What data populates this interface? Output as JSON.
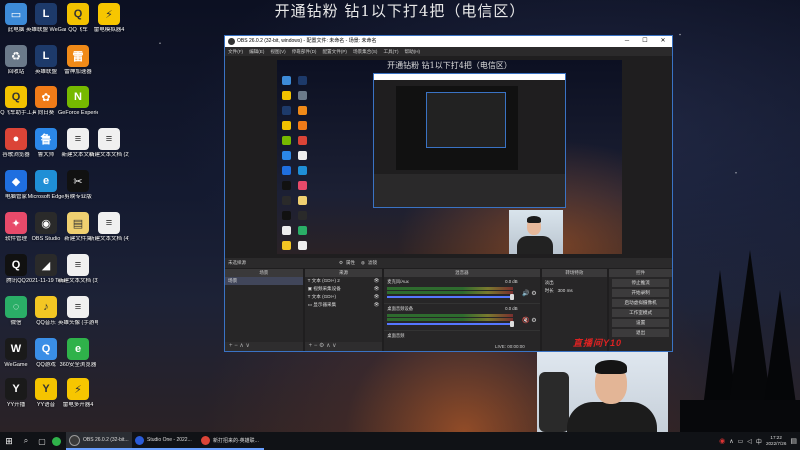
{
  "overlay_title": "开通钻粉 钻1以下打4把（电信区）",
  "desktop": {
    "icons": [
      {
        "label": "此电脑",
        "color": "#3d8bd8",
        "glyph": "▭"
      },
      {
        "label": "英雄联盟 WeGame版",
        "color": "#1d3a6a",
        "glyph": "L"
      },
      {
        "label": "QQ飞车",
        "color": "#f2c200",
        "glyph": "Q"
      },
      {
        "label": "雷电模拟器4",
        "color": "#f7c600",
        "glyph": "⚡"
      },
      {
        "label": "回收站",
        "color": "#6b7a8a",
        "glyph": "♻"
      },
      {
        "label": "英雄联盟",
        "color": "#1d3a6a",
        "glyph": "L"
      },
      {
        "label": "雷神加速器",
        "color": "#f08a18",
        "glyph": "雷"
      },
      {
        "label": "QQ飞车助手工具",
        "color": "#f2c200",
        "glyph": "Q"
      },
      {
        "label": "向日葵",
        "color": "#f07b18",
        "glyph": "✿"
      },
      {
        "label": "GeForce Experience",
        "color": "#76b900",
        "glyph": "N"
      },
      {
        "label": "谷歌浏览器",
        "color": "#db4437",
        "glyph": "●"
      },
      {
        "label": "鲁大师",
        "color": "#2b87e8",
        "glyph": "鲁"
      },
      {
        "label": "新建文本文档",
        "color": "#f0f0f0",
        "glyph": "≡"
      },
      {
        "label": "新建文本文档 (2)",
        "color": "#f0f0f0",
        "glyph": "≡"
      },
      {
        "label": "电脑管家",
        "color": "#1f6fe0",
        "glyph": "◆"
      },
      {
        "label": "Microsoft Edge",
        "color": "#1f8fd6",
        "glyph": "e"
      },
      {
        "label": "剪映专业版",
        "color": "#111111",
        "glyph": "✂"
      },
      {
        "label": "软件管理",
        "color": "#e84a6a",
        "glyph": "✦"
      },
      {
        "label": "OBS Studio",
        "color": "#2a2a2a",
        "glyph": "◉"
      },
      {
        "label": "新建文件夹",
        "color": "#f0d070",
        "glyph": "▤"
      },
      {
        "label": "新建文本文档 (4)",
        "color": "#f0f0f0",
        "glyph": "≡"
      },
      {
        "label": "腾讯QQ",
        "color": "#111111",
        "glyph": "Q"
      },
      {
        "label": "2021-11-19 Team AR...",
        "color": "#2a2a2a",
        "glyph": "◢"
      },
      {
        "label": "新建文本文档 (3)",
        "color": "#f0f0f0",
        "glyph": "≡"
      },
      {
        "label": "微信",
        "color": "#2aae67",
        "glyph": "◌"
      },
      {
        "label": "QQ音乐",
        "color": "#f3c623",
        "glyph": "♪"
      },
      {
        "label": "英雄头像 (手游电脑版)",
        "color": "#f0f0f0",
        "glyph": "≡"
      },
      {
        "label": "WeGame",
        "color": "#1a1a1a",
        "glyph": "W"
      },
      {
        "label": "QQ游戏",
        "color": "#3a8ee6",
        "glyph": "Q"
      },
      {
        "label": "360安全浏览器",
        "color": "#2fb24a",
        "glyph": "e"
      },
      {
        "label": "YY开播",
        "color": "#1a1a1a",
        "glyph": "Y"
      },
      {
        "label": "YY语音",
        "color": "#f5c400",
        "glyph": "Y"
      },
      {
        "label": "雷电多开器4",
        "color": "#f7c600",
        "glyph": "⚡"
      }
    ]
  },
  "obs": {
    "title": "OBS 26.0.2 (32-bit, windows) - 配置文件: 未命名 - 场景: 未命名",
    "menu": [
      "文件(F)",
      "编辑(E)",
      "视图(V)",
      "停靠部件(D)",
      "配置文件(P)",
      "场景集合(S)",
      "工具(T)",
      "帮助(H)"
    ],
    "preview_title": "开通钻粉 钻1以下打4把（电信区）",
    "no_source_selected": "未选择源",
    "properties_label": "属性",
    "filters_label": "滤镜",
    "docks": {
      "scenes": {
        "header": "场景",
        "items": [
          "场景"
        ]
      },
      "sources": {
        "header": "来源",
        "items": [
          "文本 (GDI+) 2",
          "视频采集设备",
          "文本 (GDI+)",
          "显示器采集"
        ]
      },
      "mixer": {
        "header": "混音器",
        "channels": [
          {
            "name": "麦克风/Aux",
            "db": "0.0 dB"
          },
          {
            "name": "桌面音频设备",
            "db": "0.0 dB"
          },
          {
            "name": "桌面音频",
            "db": ""
          }
        ]
      },
      "transitions": {
        "header": "转场特效",
        "type": "淡出",
        "duration_label": "时长",
        "duration": "300 ms"
      },
      "controls": {
        "header": "控件",
        "buttons": [
          "停止推流",
          "开始录制",
          "启动虚拟摄像机",
          "工作室模式",
          "设置",
          "退出"
        ]
      }
    },
    "status": {
      "live": "LIVE:",
      "time": "00:00:00"
    }
  },
  "watermark": "直播间Y10",
  "taskbar": {
    "apps": [
      {
        "label": "OBS 26.0.2 (32-bit...",
        "color": "#3a3a3a"
      },
      {
        "label": "Studio One - 2022...",
        "color": "#2a5bd8"
      },
      {
        "label": "新打招来的-英雄联...",
        "color": "#db4437"
      }
    ],
    "time": "17:22",
    "date": "2022/7/26"
  }
}
